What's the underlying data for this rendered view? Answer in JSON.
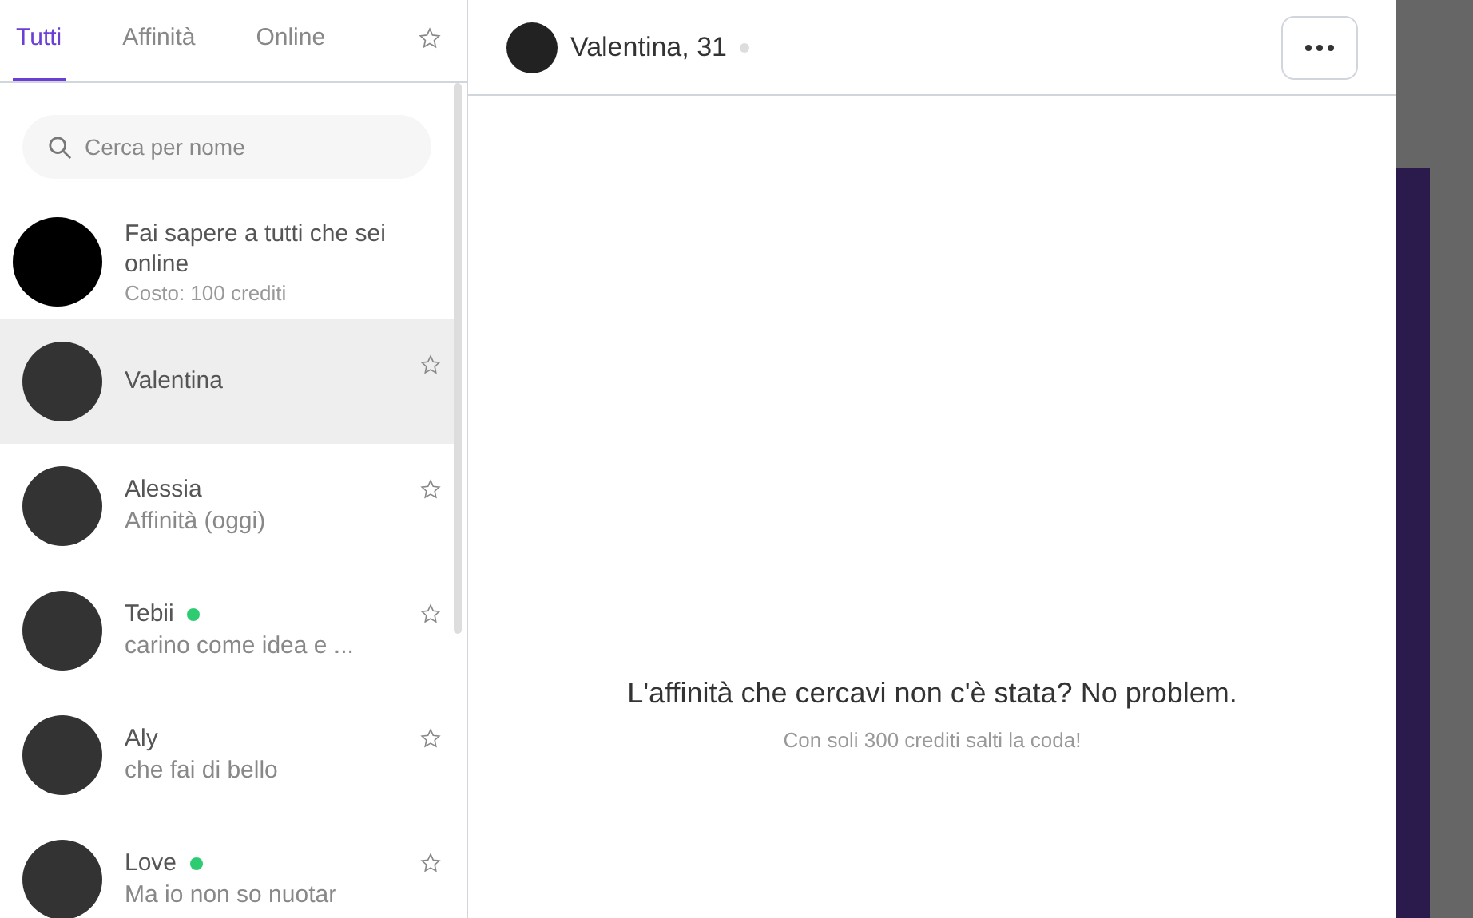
{
  "tabs": [
    {
      "label": "Tutti",
      "selected": true
    },
    {
      "label": "Affinità",
      "selected": false
    },
    {
      "label": "Online",
      "selected": false
    }
  ],
  "search": {
    "placeholder": "Cerca per nome"
  },
  "promo": {
    "title": "Fai sapere a tutti che sei online",
    "subtitle": "Costo: 100 crediti"
  },
  "contacts": [
    {
      "name": "Valentina",
      "selected": true,
      "online": false
    },
    {
      "name": "Alessia",
      "message": "Affinità (oggi)",
      "selected": false,
      "online": false
    },
    {
      "name": "Tebii",
      "message": "carino come idea e ...",
      "selected": false,
      "online": true
    },
    {
      "name": "Aly",
      "message": "che fai di bello",
      "selected": false,
      "online": false
    },
    {
      "name": "Love",
      "message": "Ma io non so nuotar",
      "selected": false,
      "online": true
    }
  ],
  "chat": {
    "title": "Valentina, 31",
    "online": false,
    "headline": "L'affinità che cercavi non c'è stata? No problem.",
    "subline": "Con soli 300 crediti salti la coda!"
  }
}
